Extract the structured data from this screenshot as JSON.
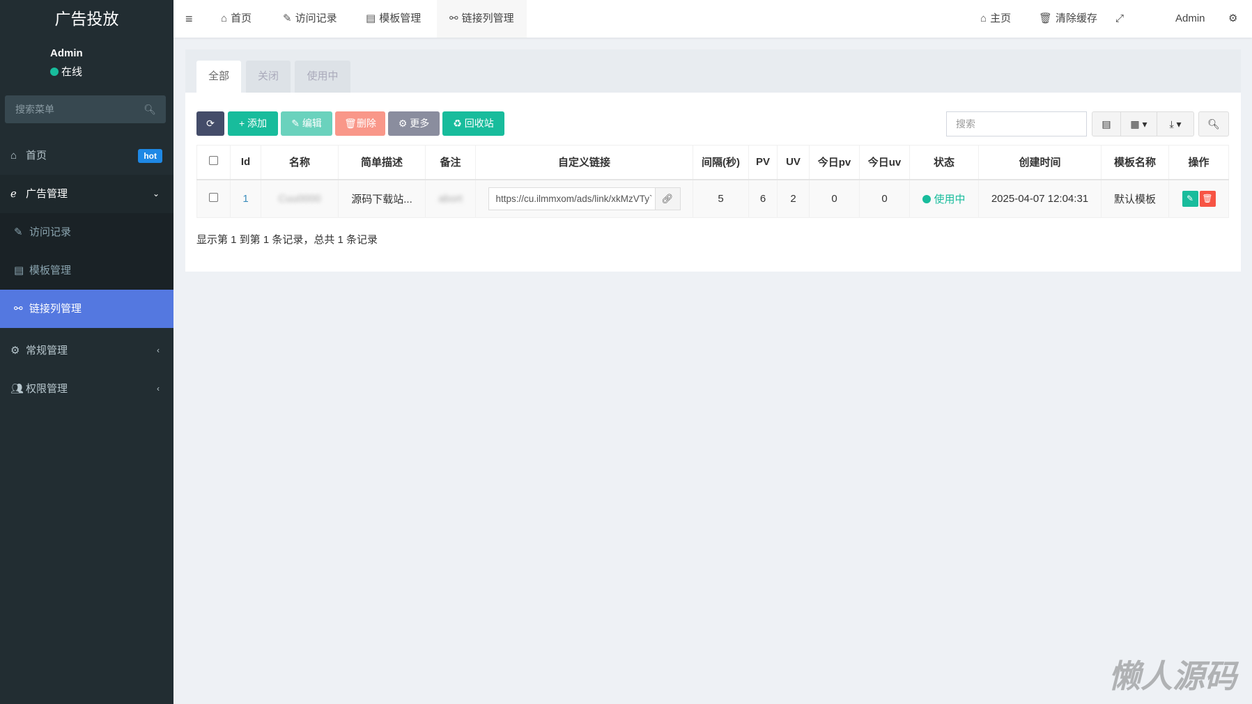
{
  "sidebar": {
    "title": "广告投放",
    "user": "Admin",
    "status": "在线",
    "search_placeholder": "搜索菜单",
    "items": [
      {
        "label": "首页",
        "badge": "hot"
      },
      {
        "label": "广告管理"
      },
      {
        "label": "访问记录"
      },
      {
        "label": "模板管理"
      },
      {
        "label": "链接列管理"
      },
      {
        "label": "常规管理"
      },
      {
        "label": "权限管理"
      }
    ]
  },
  "header": {
    "nav": [
      "首页",
      "访问记录",
      "模板管理",
      "链接列管理"
    ],
    "right": {
      "home": "主页",
      "clear_cache": "清除缓存",
      "user": "Admin"
    }
  },
  "tabs": [
    "全部",
    "关闭",
    "使用中"
  ],
  "toolbar": {
    "add": "添加",
    "edit": "编辑",
    "delete": "删除",
    "more": "更多",
    "recycle": "回收站",
    "search_placeholder": "搜索"
  },
  "table": {
    "columns": [
      "Id",
      "名称",
      "简单描述",
      "备注",
      "自定义链接",
      "间隔(秒)",
      "PV",
      "UV",
      "今日pv",
      "今日uv",
      "状态",
      "创建时间",
      "模板名称",
      "操作"
    ],
    "rows": [
      {
        "id": "1",
        "name": "Cuu0000",
        "desc": "源码下载站...",
        "remark": "abort",
        "link": "https://cu.ilmmxom/ads/link/xkMzVTy`",
        "interval": "5",
        "pv": "6",
        "uv": "2",
        "today_pv": "0",
        "today_uv": "0",
        "status": "使用中",
        "created": "2025-04-07 12:04:31",
        "template": "默认模板"
      }
    ]
  },
  "footer": "显示第 1 到第 1 条记录，总共 1 条记录",
  "watermark": "懒人源码",
  "colors": {
    "sidebar": "#222d32",
    "active": "#5478e0",
    "success": "#18bc9c",
    "danger": "#f75444"
  }
}
